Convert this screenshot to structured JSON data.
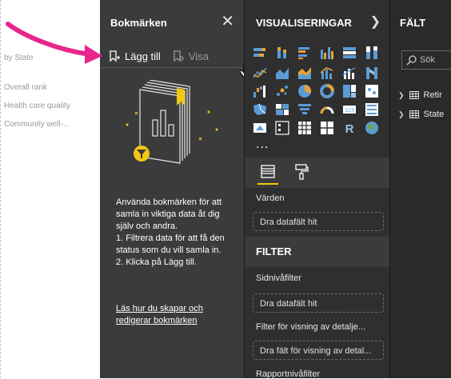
{
  "canvas": {
    "labels": [
      "by State",
      "Overall rank",
      "Health care quality",
      "Community well-..."
    ]
  },
  "bookmarks": {
    "title": "Bokmärken",
    "add_label": "Lägg till",
    "view_label": "Visa",
    "description": "Använda bokmärken för att samla in viktiga data åt dig själv och andra.\n1. Filtrera data för att få den status som du vill samla in.\n2. Klicka på Lägg till.",
    "link": "Läs hur du skapar och redigerar bokmärken"
  },
  "visualizations": {
    "title": "VISUALISERINGAR",
    "more": "...",
    "values_label": "Värden",
    "values_well": "Dra datafält hit",
    "filter_title": "FILTER",
    "page_filter_label": "Sidnivåfilter",
    "page_filter_well": "Dra datafält hit",
    "drill_label": "Filter för visning av detalje...",
    "drill_well": "Dra fält för visning av detal...",
    "report_filter_label": "Rapportnivåfilter"
  },
  "fields": {
    "title": "FÄLT",
    "search_placeholder": "Sök",
    "items": [
      "Retir",
      "State"
    ]
  },
  "colors": {
    "accent_yellow": "#f2c811",
    "arrow_pink": "#e8268d",
    "viz_blue": "#5b9bd5",
    "viz_orange": "#e8a13a"
  }
}
